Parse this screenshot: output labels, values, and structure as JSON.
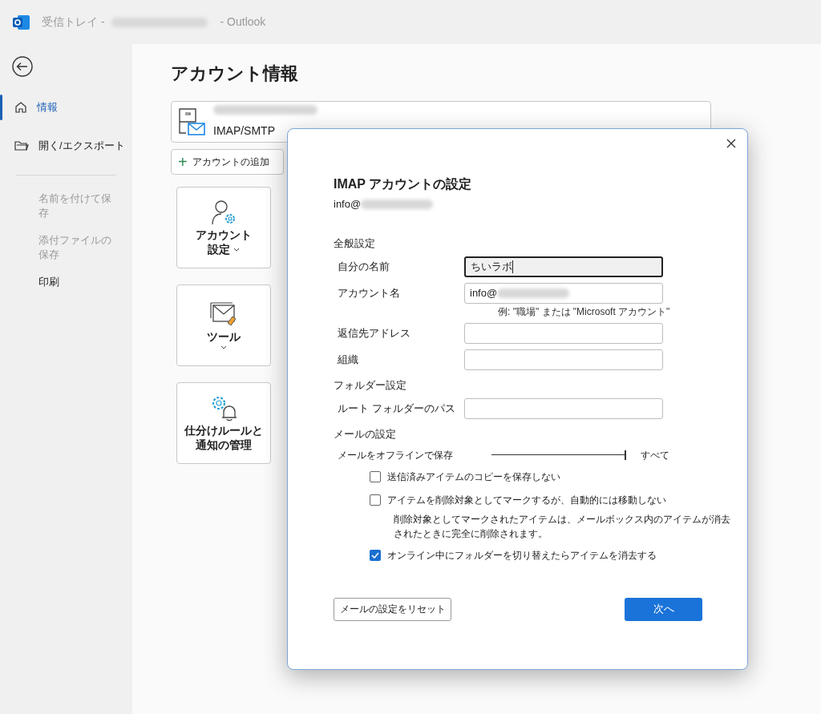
{
  "title_bar": {
    "title_prefix": "受信トレイ -",
    "redacted": true,
    "title_suffix": "- Outlook"
  },
  "sidebar": {
    "nav_items": [
      {
        "label": "情報",
        "kind": "home",
        "selected": true
      },
      {
        "label": "開く/エクスポート",
        "kind": "folder",
        "selected": false
      }
    ],
    "more_items": [
      {
        "label": "名前を付けて保存",
        "disabled": true
      },
      {
        "label": "添付ファイルの保存",
        "disabled": true
      },
      {
        "label": "印刷",
        "disabled": false
      }
    ]
  },
  "main": {
    "heading": "アカウント情報",
    "account": {
      "redacted": true,
      "type_label": "IMAP/SMTP"
    },
    "add_button": {
      "icon": "+",
      "label": "アカウントの追加"
    },
    "tiles": [
      {
        "kind": "account",
        "lines": [
          "アカウント",
          "設定"
        ],
        "dropdown": true
      },
      {
        "kind": "tools",
        "lines": [
          "ツール"
        ],
        "dropdown": true
      },
      {
        "kind": "rules",
        "lines": [
          "仕分けルールと",
          "通知の管理"
        ],
        "dropdown": false
      }
    ]
  },
  "dialog": {
    "title": "IMAP アカウントの設定",
    "email": "info@",
    "email_redacted": true,
    "sections": [
      {
        "heading": "全般設定",
        "rows": [
          {
            "kind": "field",
            "label": "自分の名前",
            "value": "ちいラボ",
            "focused": true,
            "redacted": false
          },
          {
            "kind": "field",
            "label": "アカウント名",
            "value": "info@",
            "focused": false,
            "redacted": true
          },
          {
            "kind": "hint",
            "text": "例: \"職場\" または \"Microsoft アカウント\""
          },
          {
            "kind": "field",
            "label": "返信先アドレス",
            "focused": false,
            "redacted": false
          },
          {
            "kind": "field",
            "label": "組織",
            "focused": false,
            "redacted": false
          }
        ]
      },
      {
        "heading": "フォルダー設定",
        "rows": [
          {
            "kind": "field",
            "label": "ルート フォルダーのパス",
            "focused": false,
            "redacted": false
          }
        ]
      },
      {
        "heading": "メールの設定",
        "rows": [
          {
            "kind": "slider",
            "label": "メールをオフラインで保存",
            "level": 1,
            "reading": "すべて"
          },
          {
            "kind": "checkbox",
            "label": "送信済みアイテムのコピーを保存しない",
            "checked": false
          },
          {
            "kind": "checkbox",
            "label": "アイテムを削除対象としてマークするが、自動的には移動しない",
            "checked": false
          },
          {
            "kind": "note",
            "text": "削除対象としてマークされたアイテムは、メールボックス内のアイテムが消去されたときに完全に削除されます。"
          },
          {
            "kind": "checkbox",
            "label": "オンライン中にフォルダーを切り替えたらアイテムを消去する",
            "checked": true
          }
        ]
      }
    ],
    "buttons": [
      {
        "label": "メールの設定をリセット",
        "primary": false
      },
      {
        "label": "次へ",
        "primary": true
      }
    ]
  }
}
